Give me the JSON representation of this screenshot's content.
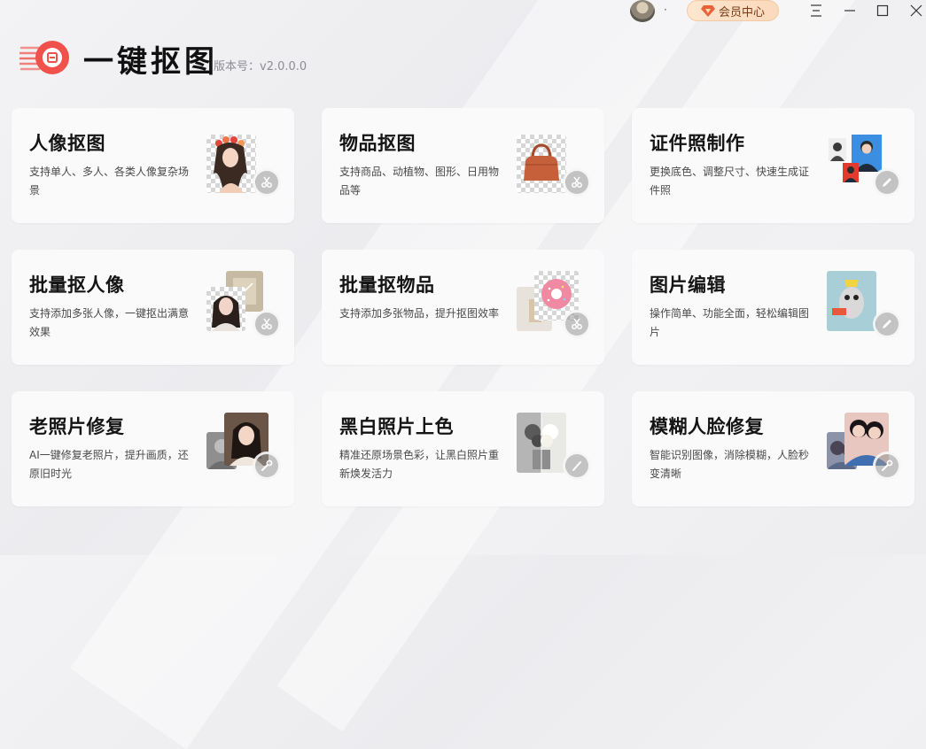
{
  "app": {
    "title": "一键抠图",
    "version": "版本号：v2.0.0.0"
  },
  "header": {
    "username": "·",
    "vip_label": "会员中心"
  },
  "colors": {
    "brand_red": "#f0514b",
    "vip_text": "#7a3b14"
  },
  "cards": [
    {
      "title": "人像抠图",
      "desc": "支持单人、多人、各类人像复杂场景",
      "icon": "scissors-icon"
    },
    {
      "title": "物品抠图",
      "desc": "支持商品、动植物、图形、日用物品等",
      "icon": "scissors-icon"
    },
    {
      "title": "证件照制作",
      "desc": "更换底色、调整尺寸、快速生成证件照",
      "icon": "pen-icon"
    },
    {
      "title": "批量抠人像",
      "desc": "支持添加多张人像，一键抠出满意效果",
      "icon": "scissors-icon"
    },
    {
      "title": "批量抠物品",
      "desc": "支持添加多张物品，提升抠图效率",
      "icon": "scissors-icon"
    },
    {
      "title": "图片编辑",
      "desc": "操作简单、功能全面，轻松编辑图片",
      "icon": "pen-icon"
    },
    {
      "title": "老照片修复",
      "desc": "AI一键修复老照片，提升画质，还原旧时光",
      "icon": "wrench-icon"
    },
    {
      "title": "黑白照片上色",
      "desc": "精准还原场景色彩，让黑白照片重新焕发活力",
      "icon": "brush-icon"
    },
    {
      "title": "模糊人脸修复",
      "desc": "智能识别图像，消除模糊，人脸秒变清晰",
      "icon": "wrench-icon"
    }
  ]
}
